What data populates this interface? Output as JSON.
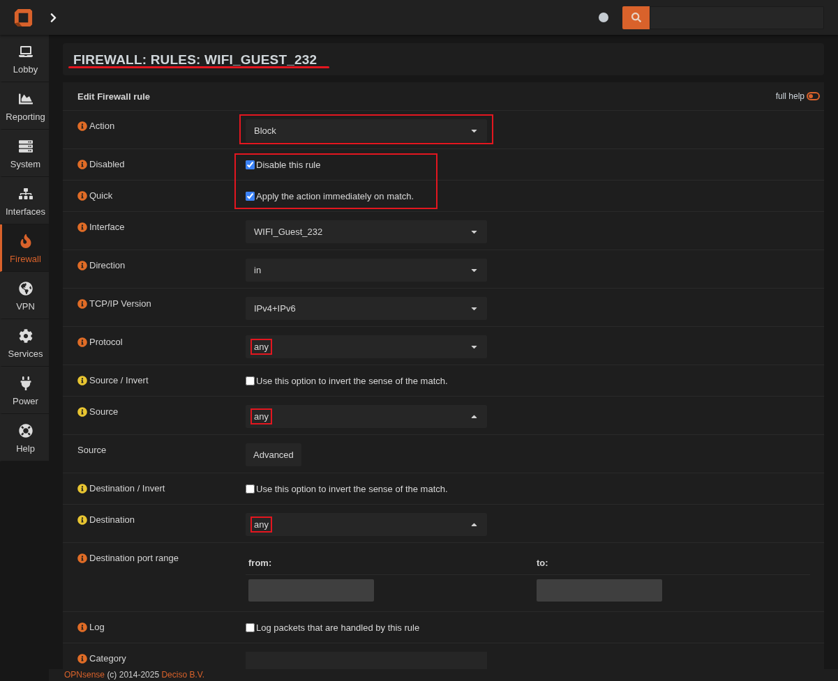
{
  "topbar": {
    "status_on": false
  },
  "sidebar": {
    "items": [
      {
        "label": "Lobby",
        "selected": false
      },
      {
        "label": "Reporting",
        "selected": false
      },
      {
        "label": "System",
        "selected": false
      },
      {
        "label": "Interfaces",
        "selected": false
      },
      {
        "label": "Firewall",
        "selected": true
      },
      {
        "label": "VPN",
        "selected": false
      },
      {
        "label": "Services",
        "selected": false
      },
      {
        "label": "Power",
        "selected": false
      },
      {
        "label": "Help",
        "selected": false
      }
    ]
  },
  "page_title": {
    "text": "FIREWALL: RULES: WIFI_GUEST_232",
    "underlined": true
  },
  "form": {
    "title": "Edit Firewall rule",
    "full_help": {
      "label": "full help",
      "on": false
    },
    "rows": [
      {
        "kind": "select",
        "label": "Action",
        "color": "#e06c26",
        "value": "Block",
        "expanded": false,
        "field_highlighted": true,
        "value_highlighted": false
      },
      {
        "kind": "group",
        "highlighted": true,
        "rows": [
          {
            "kind": "checkbox",
            "label": "Disabled",
            "color": "#e06c26",
            "checked": true,
            "text": "Disable this rule"
          },
          {
            "kind": "checkbox",
            "label": "Quick",
            "color": "#e06c26",
            "checked": true,
            "text": "Apply the action immediately on match."
          }
        ]
      },
      {
        "kind": "select",
        "label": "Interface",
        "color": "#e06c26",
        "value": "WIFI_Guest_232",
        "expanded": false,
        "field_highlighted": false,
        "value_highlighted": false
      },
      {
        "kind": "select",
        "label": "Direction",
        "color": "#e06c26",
        "value": "in",
        "expanded": false,
        "field_highlighted": false,
        "value_highlighted": false
      },
      {
        "kind": "select",
        "label": "TCP/IP Version",
        "color": "#e06c26",
        "value": "IPv4+IPv6",
        "expanded": false,
        "field_highlighted": false,
        "value_highlighted": false
      },
      {
        "kind": "select",
        "label": "Protocol",
        "color": "#e06c26",
        "value": "any",
        "expanded": false,
        "field_highlighted": false,
        "value_highlighted": true
      },
      {
        "kind": "checkbox",
        "label": "Source / Invert",
        "color": "#e8c531",
        "checked": false,
        "text": "Use this option to invert the sense of the match."
      },
      {
        "kind": "select",
        "label": "Source",
        "color": "#e8c531",
        "value": "any",
        "expanded": true,
        "field_highlighted": false,
        "value_highlighted": true
      },
      {
        "kind": "button",
        "label": "Source",
        "button": "Advanced"
      },
      {
        "kind": "checkbox",
        "label": "Destination / Invert",
        "color": "#e8c531",
        "checked": false,
        "text": "Use this option to invert the sense of the match."
      },
      {
        "kind": "select",
        "label": "Destination",
        "color": "#e8c531",
        "value": "any",
        "expanded": true,
        "field_highlighted": false,
        "value_highlighted": true
      },
      {
        "kind": "range",
        "label": "Destination port range",
        "color": "#e06c26",
        "columns": [
          "from:",
          "to:"
        ]
      },
      {
        "kind": "checkbox",
        "label": "Log",
        "color": "#e06c26",
        "checked": false,
        "text": "Log packets that are handled by this rule"
      },
      {
        "kind": "text",
        "label": "Category",
        "color": "#e06c26"
      }
    ]
  },
  "footer": {
    "brand": "OPNsense",
    "text": "(c) 2014-2025",
    "company": "Deciso B.V."
  }
}
